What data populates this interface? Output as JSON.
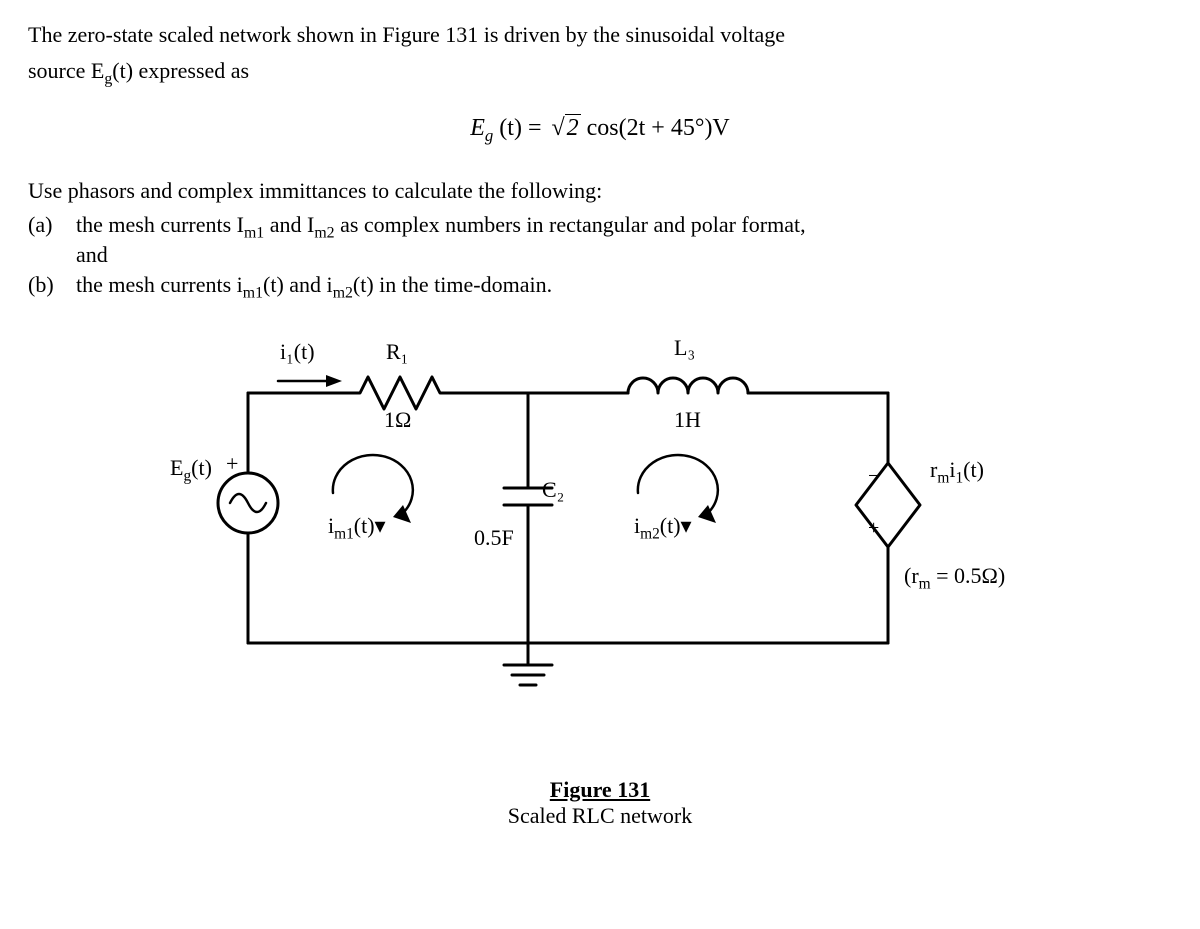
{
  "intro_l1": "The zero-state scaled network shown in Figure 131 is driven by the sinusoidal voltage",
  "intro_l2": "source Eg(t) expressed as",
  "equation": {
    "lhs_E": "E",
    "lhs_sub": "g",
    "lhs_arg": "(t) = ",
    "sqrt_rad": "2",
    "cos_part": " cos(2t + 45°)V"
  },
  "use_line": "Use phasors and complex immittances to calculate the following:",
  "item_a_label": "(a)",
  "item_a_l1": "the mesh currents Im1 and Im2 as complex numbers in rectangular and polar format,",
  "item_a_l2": "and",
  "item_b_label": "(b)",
  "item_b": "the mesh currents im1(t) and im2(t) in the time-domain.",
  "circuit": {
    "i1": "i₁(t)",
    "R1": "R₁",
    "R1_val": "1Ω",
    "L3": "L₃",
    "L3_val": "1H",
    "Eg": "Eg(t)",
    "Eg_plus": "+",
    "im1": "im1(t)",
    "C2": "C₂",
    "C2_val": "0.5F",
    "im2": "im2(t)",
    "dep_label": "rmi₁(t)",
    "dep_minus": "−",
    "dep_plus": "+",
    "rm": "(rm = 0.5Ω)"
  },
  "fig_title": "Figure 131",
  "fig_sub": "Scaled RLC network"
}
